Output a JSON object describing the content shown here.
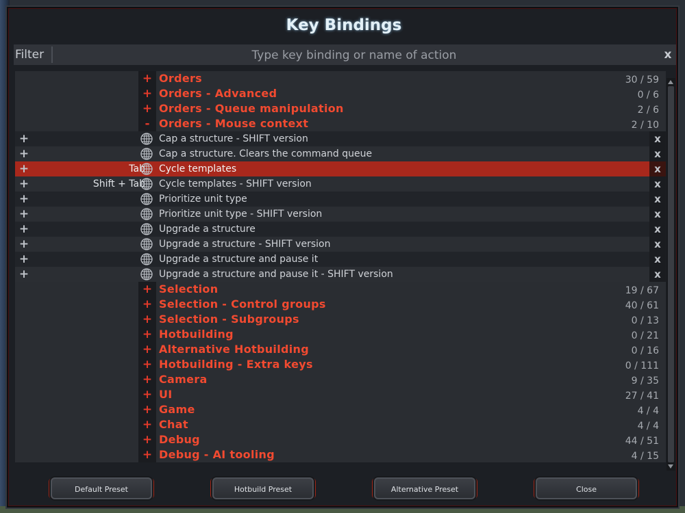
{
  "title": "Key Bindings",
  "filter": {
    "label": "Filter",
    "placeholder": "Type key binding or name of action",
    "clear": "x"
  },
  "list": [
    {
      "type": "category",
      "label": "Orders",
      "count": "30 / 59",
      "toggle": "+"
    },
    {
      "type": "category",
      "label": "Orders - Advanced",
      "count": "0 / 6",
      "toggle": "+"
    },
    {
      "type": "category",
      "label": "Orders - Queue manipulation",
      "count": "2 / 6",
      "toggle": "+"
    },
    {
      "type": "category",
      "label": "Orders - Mouse context",
      "count": "2 / 10",
      "toggle": "-"
    },
    {
      "type": "action",
      "key": "",
      "label": "Cap a structure - SHIFT version",
      "plus": "+",
      "remove": "x"
    },
    {
      "type": "action",
      "key": "",
      "label": "Cap a structure. Clears the command queue",
      "plus": "+",
      "remove": "x"
    },
    {
      "type": "action",
      "key": "Tab",
      "label": "Cycle templates",
      "plus": "+",
      "remove": "x",
      "selected": true
    },
    {
      "type": "action",
      "key": "Shift + Tab",
      "label": "Cycle templates - SHIFT version",
      "plus": "+",
      "remove": "x"
    },
    {
      "type": "action",
      "key": "",
      "label": "Prioritize unit type",
      "plus": "+",
      "remove": "x"
    },
    {
      "type": "action",
      "key": "",
      "label": "Prioritize unit type - SHIFT version",
      "plus": "+",
      "remove": "x"
    },
    {
      "type": "action",
      "key": "",
      "label": "Upgrade a structure",
      "plus": "+",
      "remove": "x"
    },
    {
      "type": "action",
      "key": "",
      "label": "Upgrade a structure - SHIFT version",
      "plus": "+",
      "remove": "x"
    },
    {
      "type": "action",
      "key": "",
      "label": "Upgrade a structure and pause it",
      "plus": "+",
      "remove": "x"
    },
    {
      "type": "action",
      "key": "",
      "label": "Upgrade a structure and pause it - SHIFT version",
      "plus": "+",
      "remove": "x"
    },
    {
      "type": "category",
      "label": "Selection",
      "count": "19 / 67",
      "toggle": "+"
    },
    {
      "type": "category",
      "label": "Selection - Control groups",
      "count": "40 / 61",
      "toggle": "+"
    },
    {
      "type": "category",
      "label": "Selection - Subgroups",
      "count": "0 / 13",
      "toggle": "+"
    },
    {
      "type": "category",
      "label": "Hotbuilding",
      "count": "0 / 21",
      "toggle": "+"
    },
    {
      "type": "category",
      "label": "Alternative Hotbuilding",
      "count": "0 / 16",
      "toggle": "+"
    },
    {
      "type": "category",
      "label": "Hotbuilding - Extra keys",
      "count": "0 / 111",
      "toggle": "+"
    },
    {
      "type": "category",
      "label": "Camera",
      "count": "9 / 35",
      "toggle": "+"
    },
    {
      "type": "category",
      "label": "UI",
      "count": "27 / 41",
      "toggle": "+"
    },
    {
      "type": "category",
      "label": "Game",
      "count": "4 / 4",
      "toggle": "+"
    },
    {
      "type": "category",
      "label": "Chat",
      "count": "4 / 4",
      "toggle": "+"
    },
    {
      "type": "category",
      "label": "Debug",
      "count": "44 / 51",
      "toggle": "+"
    },
    {
      "type": "category",
      "label": "Debug - AI tooling",
      "count": "4 / 15",
      "toggle": "+"
    }
  ],
  "buttons": {
    "default_preset": "Default Preset",
    "hotbuild_preset": "Hotbuild Preset",
    "alternative_preset": "Alternative Preset",
    "close": "Close"
  },
  "icons": {
    "row_action": "globe-icon"
  },
  "colors": {
    "category": "#f24a30",
    "selected": "#a8281c",
    "background": "#1c1f24"
  }
}
